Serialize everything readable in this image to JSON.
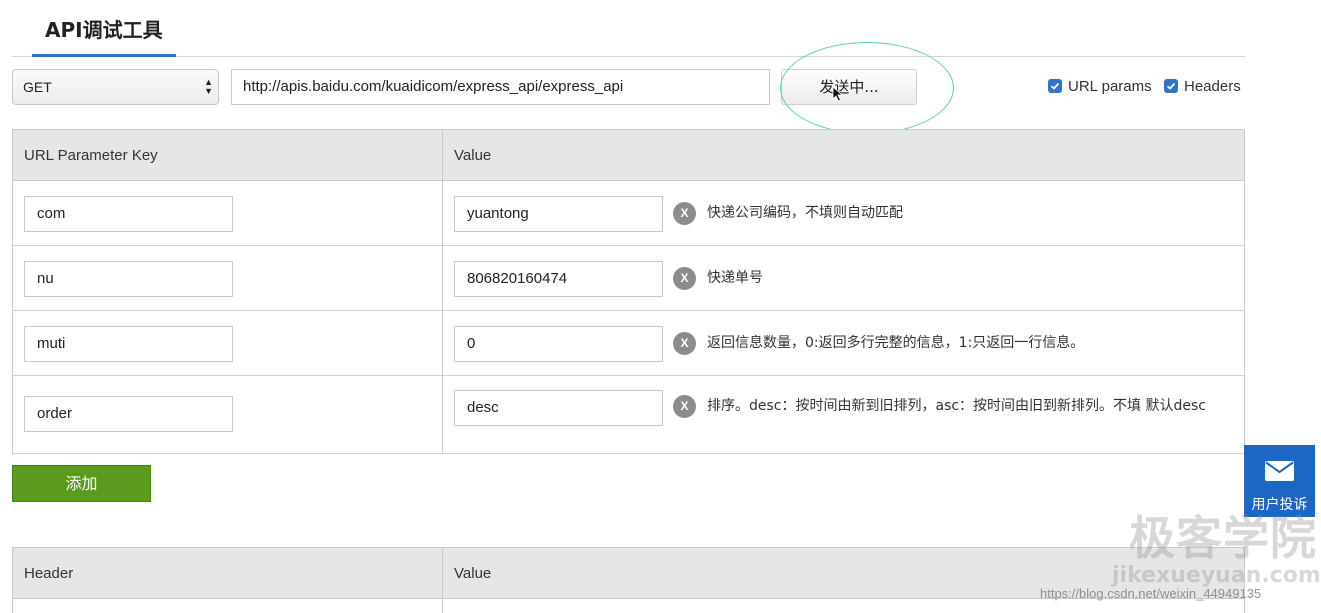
{
  "tabs": {
    "active_label": "API调试工具"
  },
  "request": {
    "method": "GET",
    "url": "http://apis.baidu.com/kuaidicom/express_api/express_api",
    "send_label": "发送中..."
  },
  "options": {
    "url_params_label": "URL params",
    "url_params_checked": true,
    "headers_label": "Headers",
    "headers_checked": true
  },
  "params_table": {
    "key_header": "URL Parameter Key",
    "value_header": "Value",
    "rows": [
      {
        "key": "com",
        "value": "yuantong",
        "description": "快递公司编码，不填则自动匹配"
      },
      {
        "key": "nu",
        "value": "806820160474",
        "description": "快递单号"
      },
      {
        "key": "muti",
        "value": "0",
        "description": "返回信息数量，0:返回多行完整的信息，1:只返回一行信息。"
      },
      {
        "key": "order",
        "value": "desc",
        "description": "排序。desc：按时间由新到旧排列，asc：按时间由旧到新排列。不填 默认desc"
      }
    ],
    "clear_icon_glyph": "X"
  },
  "add_label": "添加",
  "headers_table": {
    "key_header": "Header",
    "value_header": "Value"
  },
  "feedback": {
    "label": "用户投诉",
    "icon": "mail-icon",
    "color": "#1e66c4"
  },
  "watermark": {
    "title": "极客学院",
    "domain": "jikexueyuan.com"
  },
  "csdn_watermark": "https://blog.csdn.net/weixin_44949135",
  "colors": {
    "accent": "#2f74c9",
    "add_button": "#5a9a1e",
    "highlight": "#5fcbc4"
  }
}
